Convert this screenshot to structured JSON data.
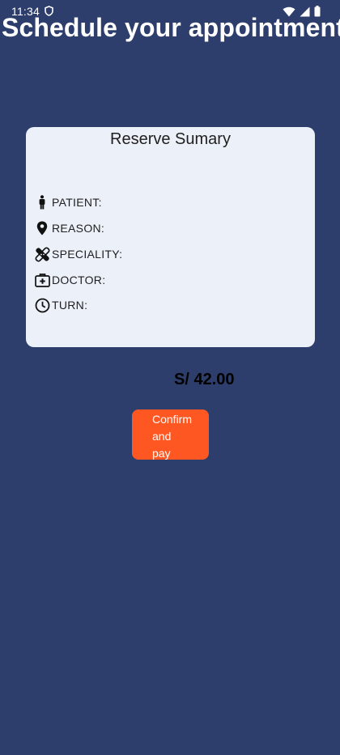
{
  "status_bar": {
    "time": "11:34",
    "icons": [
      "shield-icon",
      "wifi-icon",
      "signal-icon",
      "battery-icon"
    ]
  },
  "header": {
    "title": "Schedule your appointment"
  },
  "summary_card": {
    "title": "Reserve Sumary",
    "rows": [
      {
        "icon": "person-icon",
        "label": "PATIENT:"
      },
      {
        "icon": "location-pin-icon",
        "label": "REASON:"
      },
      {
        "icon": "bandage-icon",
        "label": "SPECIALITY:"
      },
      {
        "icon": "medical-kit-icon",
        "label": "DOCTOR:"
      },
      {
        "icon": "clock-icon",
        "label": "TURN:"
      }
    ]
  },
  "price": "S/ 42.00",
  "confirm_button": {
    "label": "Confirm and pay"
  },
  "colors": {
    "background": "#2d3e6d",
    "card": "#ecf0f9",
    "accent_button": "#ff5722"
  }
}
